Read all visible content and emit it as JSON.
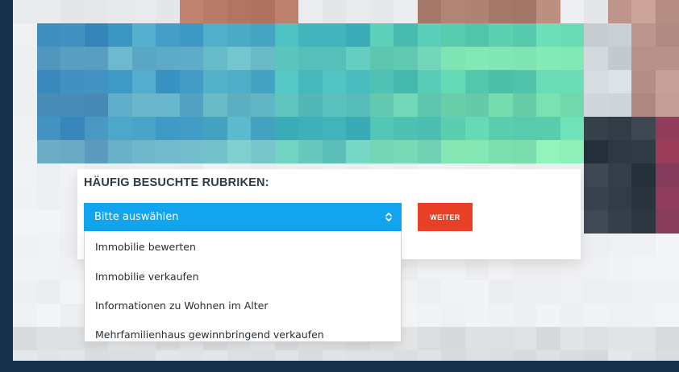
{
  "section": {
    "title": "HÄUFIG BESUCHTE RUBRIKEN:"
  },
  "select": {
    "selected_label": "Bitte auswählen",
    "arrows_icon": "chevron-up-down-icon",
    "options": [
      "Immobilie bewerten",
      "Immobilie verkaufen",
      "Informationen zu Wohnen im Alter",
      "Mehrfamilienhaus gewinnbringend verkaufen"
    ]
  },
  "weiter_button": {
    "label": "WEITER"
  },
  "colors": {
    "select_blue": "#12a4ee",
    "button_red": "#e83f26",
    "outer_background": "#14304b",
    "title_text": "#2d3c47"
  }
}
